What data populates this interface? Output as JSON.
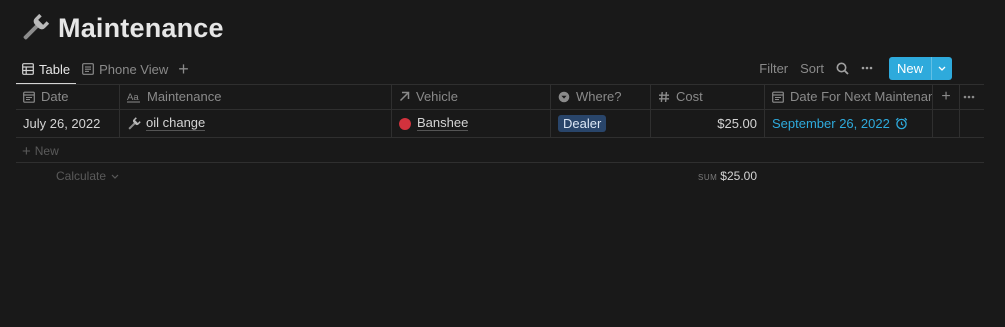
{
  "page": {
    "title": "Maintenance",
    "icon": "wrench-icon"
  },
  "views": {
    "tabs": [
      {
        "label": "Table",
        "icon": "table-icon",
        "active": true
      },
      {
        "label": "Phone View",
        "icon": "list-icon",
        "active": false
      }
    ]
  },
  "toolbar": {
    "filter": "Filter",
    "sort": "Sort",
    "new_label": "New"
  },
  "table": {
    "columns": {
      "date": "Date",
      "maintenance": "Maintenance",
      "vehicle": "Vehicle",
      "where": "Where?",
      "cost": "Cost",
      "next": "Date For Next Maintenance"
    },
    "rows": [
      {
        "date": "July 26, 2022",
        "maintenance": "oil change",
        "vehicle": "Banshee",
        "where": "Dealer",
        "cost": "$25.00",
        "next": "September 26, 2022"
      }
    ],
    "new_row_label": "New",
    "calculate_label": "Calculate",
    "sum_label": "SUM",
    "sum_value": "$25.00"
  },
  "colors": {
    "accent": "#2eaadc",
    "vehicle_dot": "#d1323d",
    "tag_bg": "#29456a"
  }
}
